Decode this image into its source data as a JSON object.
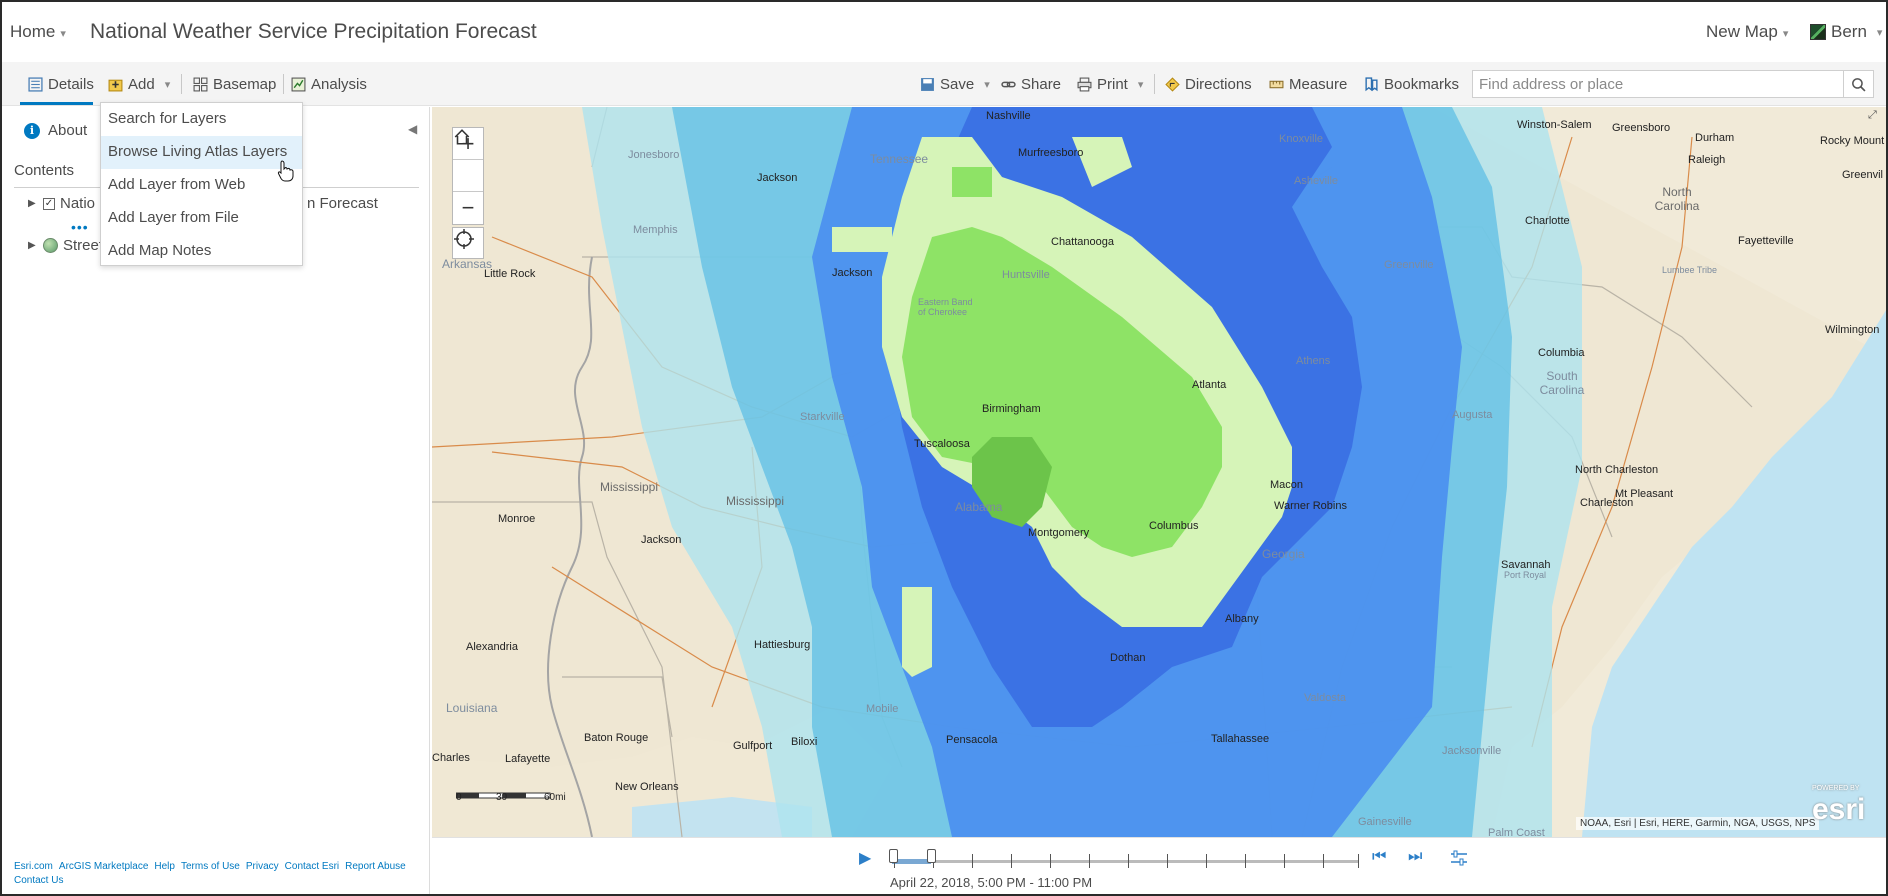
{
  "header": {
    "home_label": "Home",
    "title": "National Weather Service Precipitation Forecast",
    "new_map_label": "New Map",
    "user_name": "Bern"
  },
  "toolbar": {
    "details": "Details",
    "add": "Add",
    "basemap": "Basemap",
    "analysis": "Analysis",
    "save": "Save",
    "share": "Share",
    "print": "Print",
    "directions": "Directions",
    "measure": "Measure",
    "bookmarks": "Bookmarks",
    "search_placeholder": "Find address or place"
  },
  "add_menu": {
    "items": [
      {
        "label": "Search for Layers"
      },
      {
        "label": "Browse Living Atlas Layers"
      },
      {
        "label": "Add Layer from Web"
      },
      {
        "label": "Add Layer from File"
      },
      {
        "label": "Add Map Notes"
      }
    ],
    "hovered_item": "Browse Living Atlas Layers"
  },
  "panel": {
    "about": "About",
    "contents": "Contents",
    "layers": [
      {
        "name_start": "Natio",
        "name_end": "n Forecast",
        "checked": true
      },
      {
        "name_start": "Street"
      }
    ],
    "footer_links": [
      "Esri.com",
      "ArcGIS Marketplace",
      "Help",
      "Terms of Use",
      "Privacy",
      "Contact Esri",
      "Report Abuse",
      "Contact Us"
    ]
  },
  "map": {
    "cities": [
      "Nashville",
      "Murfreesboro",
      "Knoxville",
      "Winston-Salem",
      "Greensboro",
      "Durham",
      "Raleigh",
      "Rocky Mount",
      "Greenvil",
      "Jonesboro",
      "Jackson",
      "Tennessee",
      "Asheville",
      "North Carolina",
      "Memphis",
      "Chattanooga",
      "Charlotte",
      "Fayetteville",
      "Jackson",
      "Arkansas",
      "Little Rock",
      "Huntsville",
      "Greenville",
      "Lumbee Tribe",
      "Wilmington",
      "Eastern Band of Cherokee",
      "Athens",
      "Columbia",
      "South Carolina",
      "Atlanta",
      "Starkville",
      "Birmingham",
      "Augusta",
      "Tuscaloosa",
      "Mississippi",
      "Mississippi",
      "Macon",
      "Warner Robins",
      "North Charleston",
      "Mt Pleasant",
      "Charleston",
      "Monroe",
      "Jackson",
      "Alabama",
      "Montgomery",
      "Columbus",
      "Georgia",
      "Savannah",
      "Albany",
      "Alexandria",
      "Hattiesburg",
      "Dothan",
      "Louisiana",
      "Mobile",
      "Valdosta",
      "Baton Rouge",
      "Gulfport",
      "Biloxi",
      "Pensacola",
      "Tallahassee",
      "Jacksonville",
      "Charles",
      "Lafayette",
      "New Orleans",
      "Gainesville",
      "Palm Coast",
      "Port Royal"
    ],
    "attribution": "NOAA, Esri | Esri, HERE, Garmin, NGA, USGS, NPS",
    "scale": {
      "zero": "0",
      "mid": "30",
      "end": "60mi"
    },
    "esri_label": "esri",
    "esri_powered": "POWERED BY",
    "zoom_in": "+",
    "zoom_out": "−"
  },
  "time_slider": {
    "label": "April 22, 2018, 5:00 PM - 11:00 PM"
  },
  "colors": {
    "accent": "#0079c1",
    "precip_light": "#aee3ef",
    "precip_mid": "#5fbfe4",
    "precip_blue": "#4a8ef0",
    "precip_dark": "#3a6fe3",
    "precip_pale_green": "#d6f4b8",
    "precip_green": "#8ee366",
    "precip_dark_green": "#6cc44a"
  }
}
